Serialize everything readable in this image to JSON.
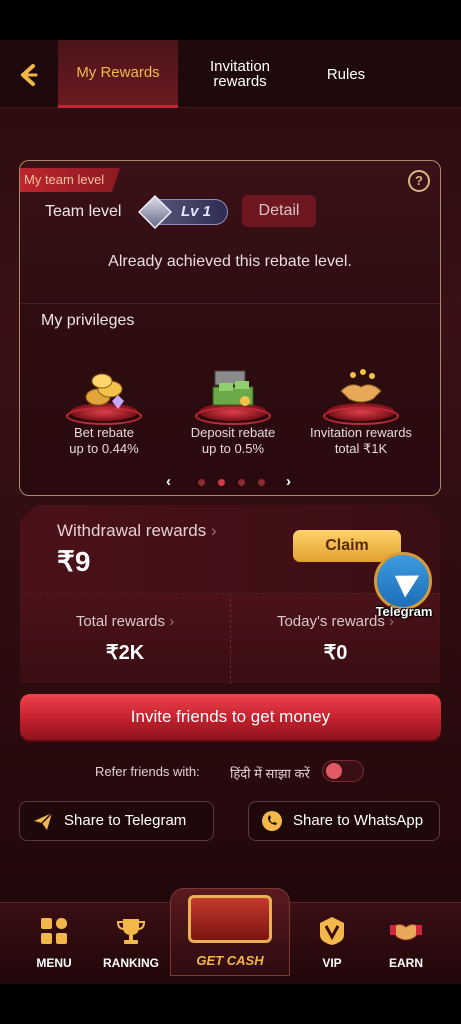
{
  "header": {
    "back_icon": "chevron-left-icon",
    "tabs": [
      {
        "label": "My Rewards",
        "active": true
      },
      {
        "label": "Invitation rewards",
        "active": false
      },
      {
        "label": "Rules",
        "active": false
      }
    ]
  },
  "team_card": {
    "tag": "My team level",
    "team_level_label": "Team level",
    "level": "Lv 1",
    "detail_label": "Detail",
    "achieved_text": "Already achieved this rebate level.",
    "privileges_title": "My privileges",
    "privileges": [
      {
        "line1": "Bet rebate",
        "line2": "up to 0.44%",
        "icon": "coins-icon"
      },
      {
        "line1": "Deposit rebate",
        "line2": "up to 0.5%",
        "icon": "money-chest-icon"
      },
      {
        "line1": "Invitation rewards",
        "line2": "total ₹1K",
        "icon": "handshake-icon"
      }
    ],
    "pager": {
      "count": 4,
      "active": 2
    }
  },
  "withdrawal": {
    "title": "Withdrawal rewards",
    "amount": "₹9",
    "claim_label": "Claim"
  },
  "stats": {
    "total_label": "Total rewards",
    "total_value": "₹2K",
    "today_label": "Today's rewards",
    "today_value": "₹0"
  },
  "telegram_float": {
    "label": "Telegram"
  },
  "invite_label": "Invite friends to get money",
  "refer": {
    "label": "Refer friends with:",
    "language": "हिंदी में साझा करें",
    "toggle_on": false
  },
  "share": {
    "telegram": "Share to Telegram",
    "whatsapp": "Share to WhatsApp"
  },
  "nav": {
    "menu": "MENU",
    "ranking": "RANKING",
    "get_cash": "GET CASH",
    "vip": "VIP",
    "earn": "EARN"
  },
  "colors": {
    "accent": "#f2b84a",
    "primary": "#c0262e",
    "background": "#2a0b0e"
  }
}
